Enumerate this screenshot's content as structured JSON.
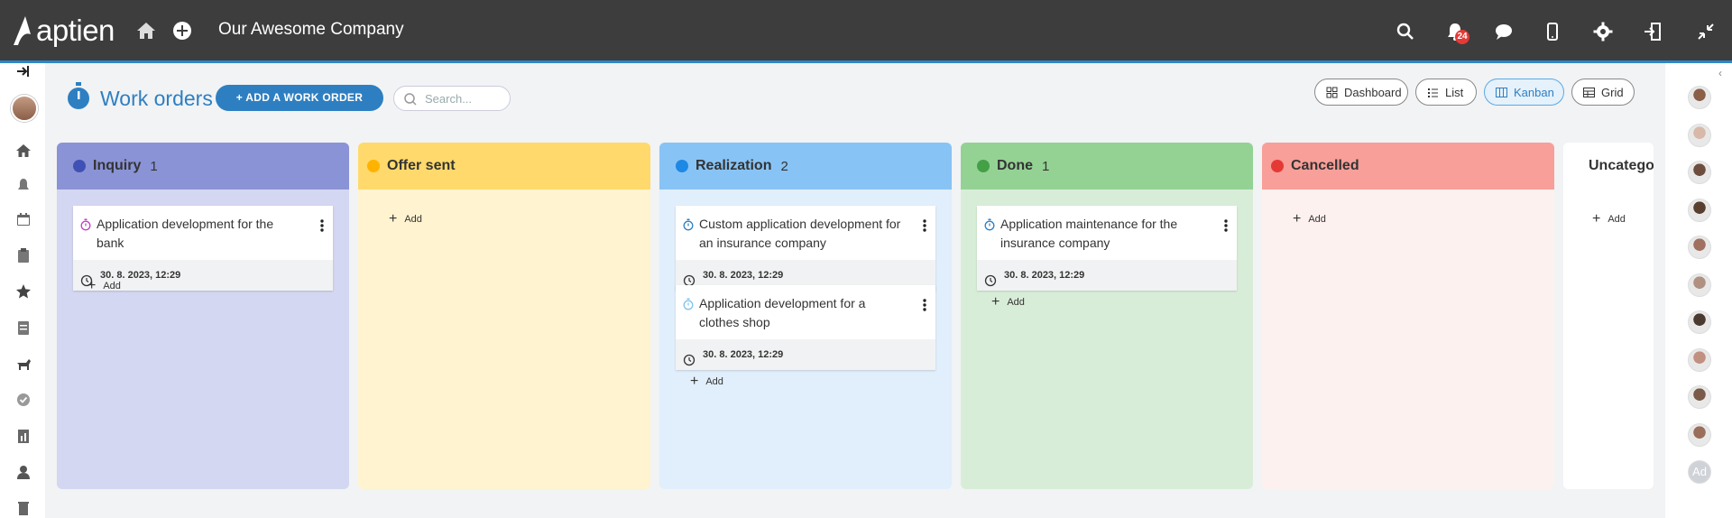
{
  "app": {
    "logo_text": "aptien",
    "company": "Our Awesome Company",
    "notification_count": "24"
  },
  "page": {
    "title": "Work orders",
    "add_button": "+ ADD A WORK ORDER",
    "search_placeholder": "Search..."
  },
  "views": [
    {
      "label": "Dashboard",
      "icon": "dashboard-icon",
      "active": false
    },
    {
      "label": "List",
      "icon": "list-icon",
      "active": false
    },
    {
      "label": "Kanban",
      "icon": "kanban-icon",
      "active": true
    },
    {
      "label": "Grid",
      "icon": "grid-icon",
      "active": false
    }
  ],
  "add_label": "Add",
  "columns": [
    {
      "name": "Inquiry",
      "count": "1",
      "dot": "#3f51b5",
      "head_bg": "#8a93d6",
      "body_bg": "#d4d7f1",
      "cards": [
        {
          "title": "Application development for the bank",
          "date": "30. 8. 2023, 12:29",
          "icon_color": "#c040c0"
        }
      ]
    },
    {
      "name": "Offer sent",
      "count": "",
      "dot": "#ffb300",
      "head_bg": "#ffd96b",
      "body_bg": "#fff3d0",
      "cards": []
    },
    {
      "name": "Realization",
      "count": "2",
      "dot": "#1e88e5",
      "head_bg": "#88c3f5",
      "body_bg": "#e1eefb",
      "cards": [
        {
          "title": "Custom application development for an insurance company",
          "date": "30. 8. 2023, 12:29",
          "icon_color": "#2e7fc1"
        },
        {
          "title": "Application development for a clothes shop",
          "date": "30. 8. 2023, 12:29",
          "icon_color": "#7ec3ef"
        }
      ]
    },
    {
      "name": "Done",
      "count": "1",
      "dot": "#43a047",
      "head_bg": "#94d294",
      "body_bg": "#d8edd8",
      "cards": [
        {
          "title": "Application maintenance for the insurance company",
          "date": "30. 8. 2023, 12:29",
          "icon_color": "#2e7fc1"
        }
      ]
    },
    {
      "name": "Cancelled",
      "count": "",
      "dot": "#e53935",
      "head_bg": "#f79f98",
      "body_bg": "#fdf1ef",
      "cards": []
    },
    {
      "name": "Uncategor",
      "count": "",
      "dot": "#c8c8c8",
      "head_bg": "#ffffff",
      "body_bg": "#ffffff",
      "cards": []
    }
  ],
  "right_avatars": [
    "",
    "",
    "",
    "",
    "",
    "",
    "",
    "",
    "",
    "",
    "Ad"
  ]
}
